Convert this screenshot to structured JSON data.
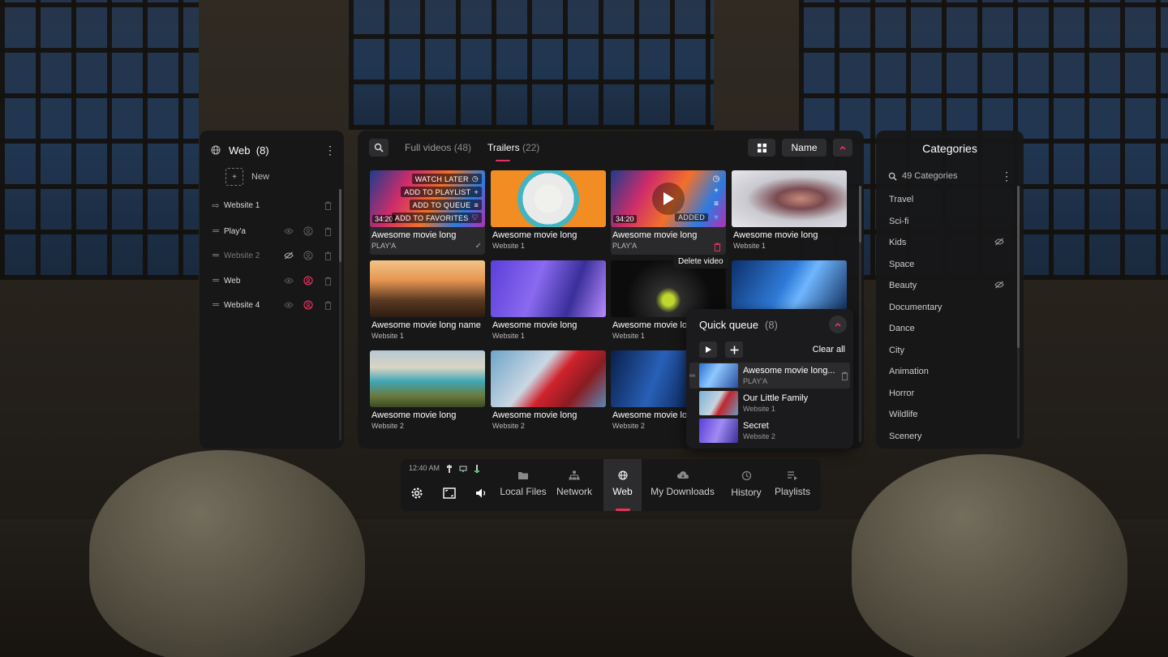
{
  "colors": {
    "accent": "#e8305f",
    "panel": "#171718"
  },
  "left_panel": {
    "title": "Web",
    "count": "(8)",
    "new_label": "New",
    "sites": [
      {
        "name": "Website 1",
        "dim": false,
        "type": "arrow"
      },
      {
        "name": "Play'a",
        "dim": false,
        "type": "drag"
      },
      {
        "name": "Website 2",
        "dim": true,
        "type": "drag"
      },
      {
        "name": "Web",
        "dim": false,
        "type": "drag"
      },
      {
        "name": "Website 4",
        "dim": false,
        "type": "drag"
      }
    ]
  },
  "main": {
    "tabs": [
      {
        "label": "Full videos",
        "count": "(48)",
        "active": false
      },
      {
        "label": "Trailers",
        "count": "(22)",
        "active": true
      }
    ],
    "sort_label": "Name",
    "hover_menu": {
      "watch_later": "WATCH LATER",
      "add_to_playlist": "ADD TO PLAYLIST",
      "add_to_queue": "ADD TO QUEUE",
      "add_to_favorites": "ADD TO FAVORITES"
    },
    "added_label": "ADDED",
    "tooltip": "Delete video",
    "videos": [
      {
        "title": "Awesome movie long",
        "source": "PLAY'A",
        "duration": "34:20",
        "thumb": "t-abstract"
      },
      {
        "title": "Awesome movie long",
        "source": "Website 1",
        "thumb": "t-orange"
      },
      {
        "title": "Awesome movie long",
        "source": "PLAY'A",
        "duration": "34:20",
        "thumb": "t-abstract"
      },
      {
        "title": "Awesome movie long",
        "source": "Website 1",
        "thumb": "t-woman"
      },
      {
        "title": "Awesome movie long name",
        "source": "Website 1",
        "thumb": "t-ship"
      },
      {
        "title": "Awesome movie long",
        "source": "Website 1",
        "thumb": "t-vr"
      },
      {
        "title": "Awesome movie lor",
        "source": "Website 1",
        "thumb": "t-drink"
      },
      {
        "title": "",
        "source": "",
        "thumb": "t-blue"
      },
      {
        "title": "Awesome movie long",
        "source": "Website 2",
        "thumb": "t-coast"
      },
      {
        "title": "Awesome movie long",
        "source": "Website 2",
        "thumb": "t-red"
      },
      {
        "title": "Awesome movie lor",
        "source": "Website 2",
        "thumb": "t-violin"
      }
    ]
  },
  "queue": {
    "title": "Quick queue",
    "count": "(8)",
    "clear_label": "Clear all",
    "items": [
      {
        "title": "Awesome movie long...",
        "source": "PLAY'A",
        "thumb": "t-band"
      },
      {
        "title": "Our Little Family",
        "source": "Website 1",
        "thumb": "t-family"
      },
      {
        "title": "Secret",
        "source": "Website 2",
        "thumb": "t-secret"
      }
    ]
  },
  "categories": {
    "title": "Categories",
    "search_label": "49 Categories",
    "items": [
      {
        "name": "Travel",
        "hidden": false
      },
      {
        "name": "Sci-fi",
        "hidden": false
      },
      {
        "name": "Kids",
        "hidden": true
      },
      {
        "name": "Space",
        "hidden": false
      },
      {
        "name": "Beauty",
        "hidden": true
      },
      {
        "name": "Documentary",
        "hidden": false
      },
      {
        "name": "Dance",
        "hidden": false
      },
      {
        "name": "City",
        "hidden": false
      },
      {
        "name": "Animation",
        "hidden": false
      },
      {
        "name": "Horror",
        "hidden": false
      },
      {
        "name": "Wildlife",
        "hidden": false
      },
      {
        "name": "Scenery",
        "hidden": false
      }
    ]
  },
  "bottom_bar": {
    "time": "12:40 AM",
    "nav": [
      {
        "label": "Local Files",
        "icon": "folder-icon",
        "active": false
      },
      {
        "label": "Network",
        "icon": "network-icon",
        "active": false
      },
      {
        "label": "Web",
        "icon": "globe-icon",
        "active": true
      },
      {
        "label": "My Downloads",
        "icon": "cloud-download-icon",
        "active": false
      },
      {
        "label": "History",
        "icon": "history-icon",
        "active": false
      },
      {
        "label": "Playlists",
        "icon": "playlist-icon",
        "active": false
      }
    ]
  }
}
